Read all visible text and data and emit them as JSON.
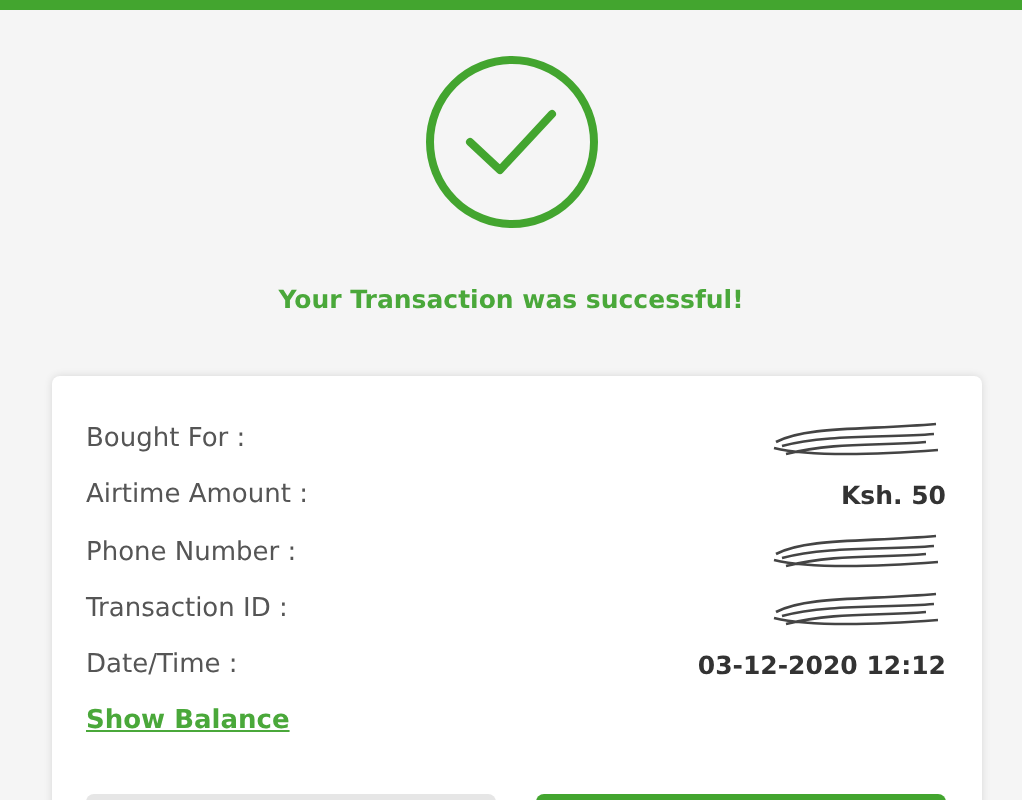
{
  "message": "Your Transaction was successful!",
  "details": [
    {
      "label": "Bought For :",
      "redacted": true
    },
    {
      "label": "Airtime Amount :",
      "value": "Ksh. 50",
      "redacted": false
    },
    {
      "label": "Phone Number :",
      "redacted": true
    },
    {
      "label": "Transaction ID :",
      "redacted": true
    },
    {
      "label": "Date/Time :",
      "value": "03-12-2020 12:12",
      "redacted": false
    }
  ],
  "link": "Show Balance"
}
